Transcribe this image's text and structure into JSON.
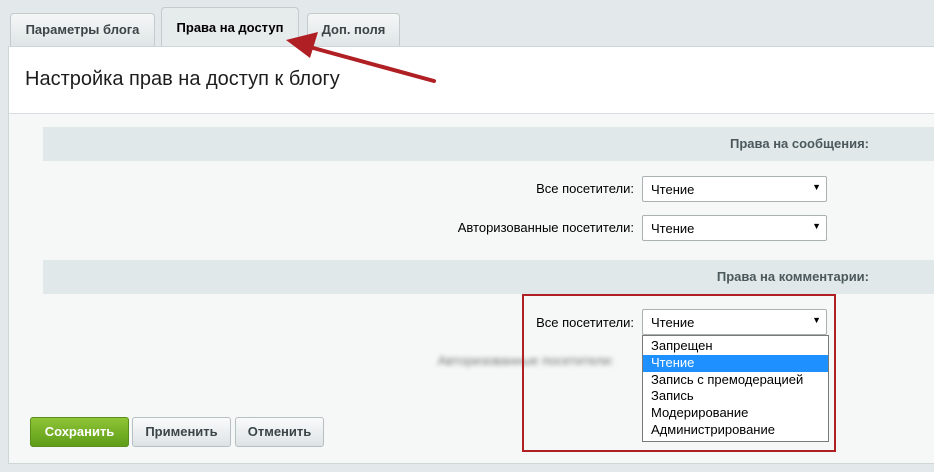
{
  "tabs": [
    {
      "label": "Параметры блога"
    },
    {
      "label": "Права на доступ"
    },
    {
      "label": "Доп. поля"
    }
  ],
  "page": {
    "title": "Настройка прав на доступ к блогу"
  },
  "posts_section": {
    "title": "Права на сообщения:",
    "rows": [
      {
        "label": "Все посетители:",
        "value": "Чтение"
      },
      {
        "label": "Авторизованные посетители:",
        "value": "Чтение"
      }
    ]
  },
  "comments_section": {
    "title": "Права на комментарии:",
    "rows": [
      {
        "label": "Все посетители:",
        "value": "Чтение"
      },
      {
        "label": "Авторизованные посетители:",
        "value": ""
      }
    ]
  },
  "dropdown": {
    "options": [
      "Запрещен",
      "Чтение",
      "Запись с премодерацией",
      "Запись",
      "Модерирование",
      "Администрирование"
    ],
    "selected": "Чтение"
  },
  "buttons": {
    "save": "Сохранить",
    "apply": "Применить",
    "cancel": "Отменить"
  },
  "colors": {
    "annotation": "#b01f24",
    "primary_button": "#6ba81f",
    "selected_option": "#1e90ff"
  }
}
